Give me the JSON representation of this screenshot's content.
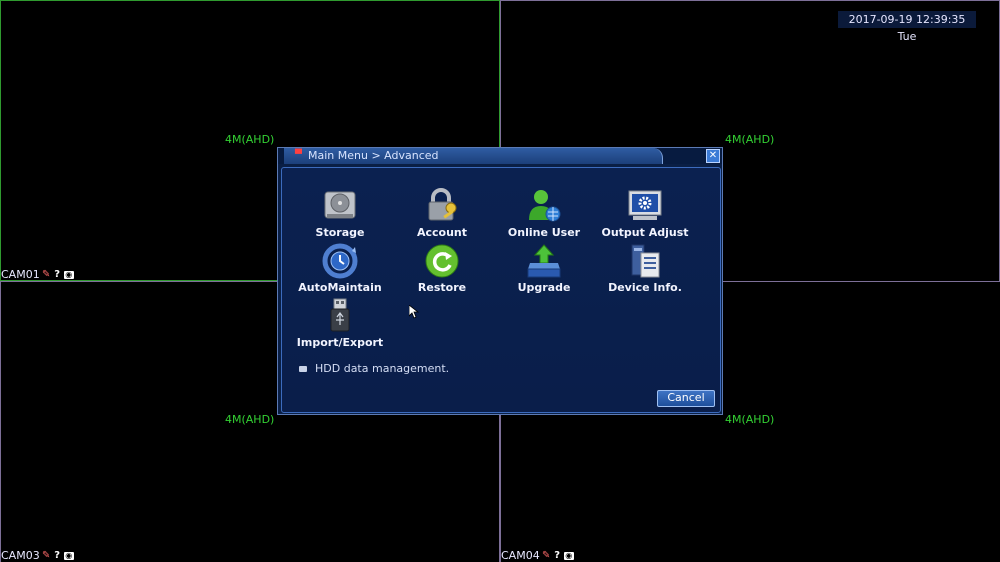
{
  "clock": "2017-09-19 12:39:35 Tue",
  "cameras": [
    {
      "label": "CAM01",
      "resolution": "4M(AHD)"
    },
    {
      "label": "",
      "resolution": "4M(AHD)"
    },
    {
      "label": "CAM03",
      "resolution": "4M(AHD)"
    },
    {
      "label": "CAM04",
      "resolution": "4M(AHD)"
    }
  ],
  "dialog": {
    "title": "Main Menu > Advanced",
    "items": [
      {
        "label": "Storage",
        "icon": "hdd-icon"
      },
      {
        "label": "Account",
        "icon": "lock-key-icon"
      },
      {
        "label": "Online User",
        "icon": "user-globe-icon"
      },
      {
        "label": "Output Adjust",
        "icon": "monitor-gear-icon"
      },
      {
        "label": "AutoMaintain",
        "icon": "auto-maintain-icon"
      },
      {
        "label": "Restore",
        "icon": "restore-icon"
      },
      {
        "label": "Upgrade",
        "icon": "upgrade-icon"
      },
      {
        "label": "Device Info.",
        "icon": "device-info-icon"
      },
      {
        "label": "Import/Export",
        "icon": "usb-icon"
      }
    ],
    "hint": "HDD data management.",
    "cancel_label": "Cancel"
  }
}
